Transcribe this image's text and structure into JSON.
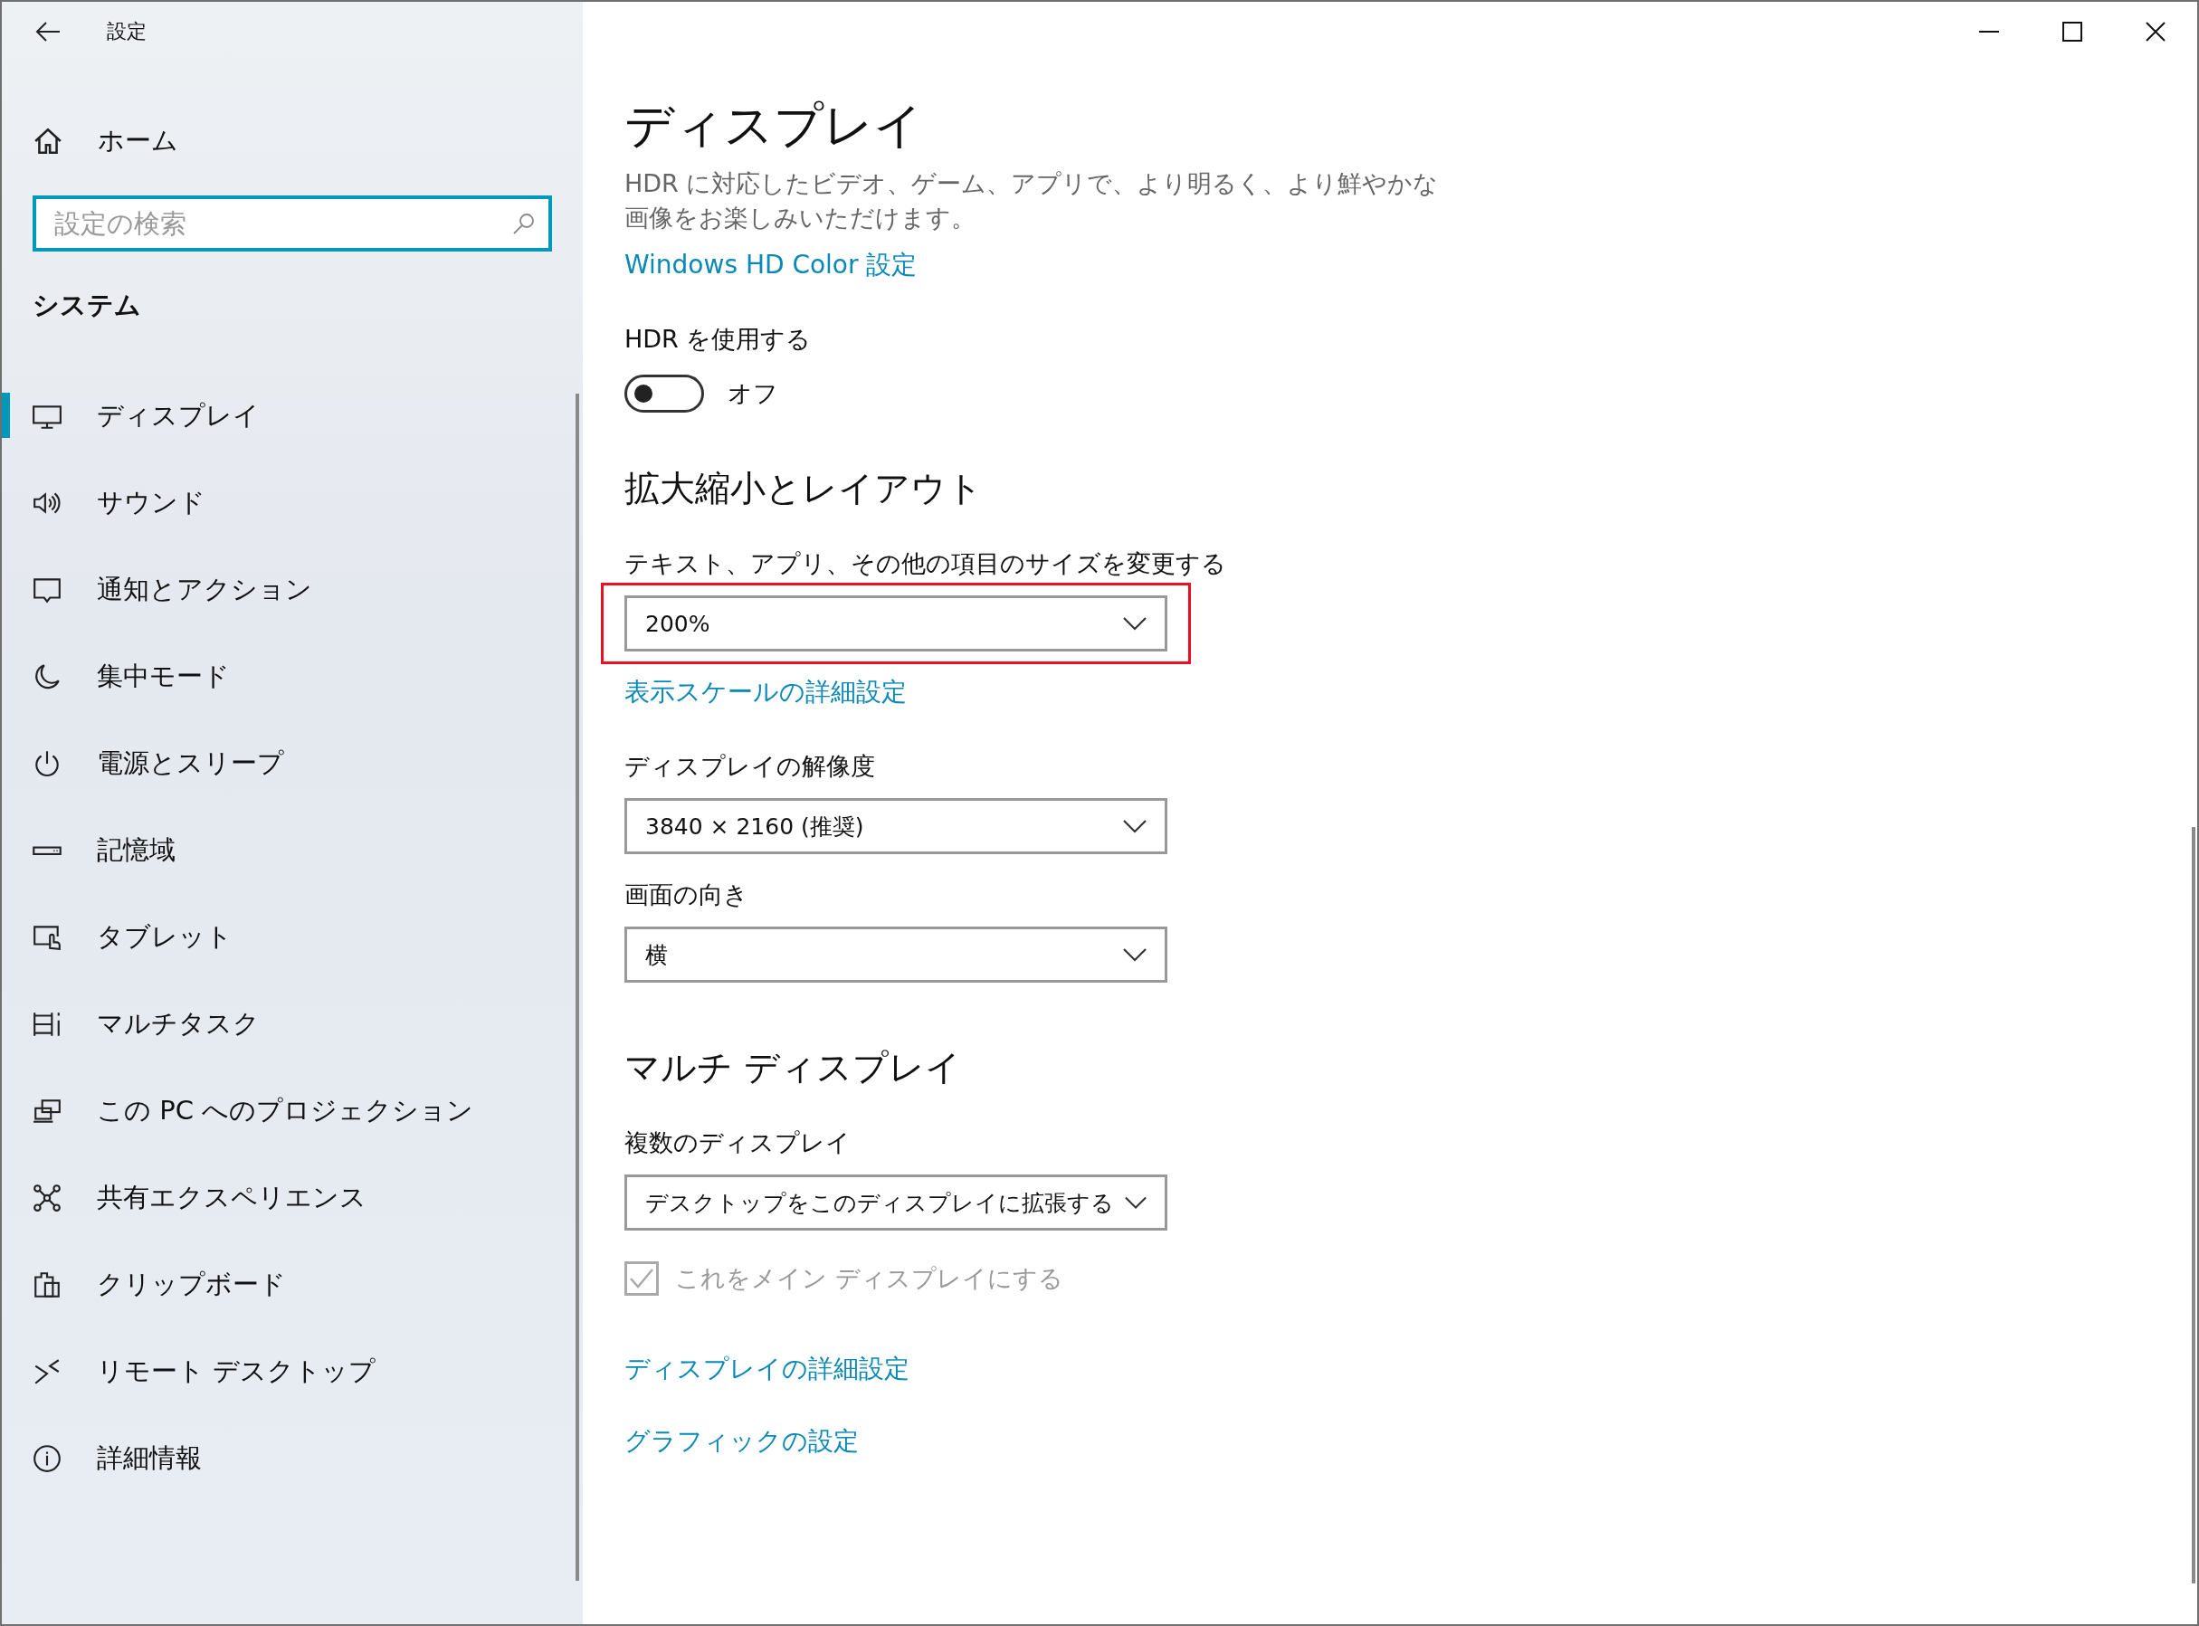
{
  "window": {
    "title": "設定"
  },
  "sidebar": {
    "home": "ホーム",
    "search": {
      "placeholder": "設定の検索"
    },
    "section": "システム",
    "items": [
      {
        "label": "ディスプレイ",
        "selected": true
      },
      {
        "label": "サウンド",
        "selected": false
      },
      {
        "label": "通知とアクション",
        "selected": false
      },
      {
        "label": "集中モード",
        "selected": false
      },
      {
        "label": "電源とスリープ",
        "selected": false
      },
      {
        "label": "記憶域",
        "selected": false
      },
      {
        "label": "タブレット",
        "selected": false
      },
      {
        "label": "マルチタスク",
        "selected": false
      },
      {
        "label": "この PC へのプロジェクション",
        "selected": false
      },
      {
        "label": "共有エクスペリエンス",
        "selected": false
      },
      {
        "label": "クリップボード",
        "selected": false
      },
      {
        "label": "リモート デスクトップ",
        "selected": false
      },
      {
        "label": "詳細情報",
        "selected": false
      }
    ]
  },
  "main": {
    "title": "ディスプレイ",
    "content": [
      {
        "kind": "description",
        "text": "HDR に対応したビデオ、ゲーム、アプリで、より明るく、より鮮やかな画像をお楽しみいただけます。"
      },
      {
        "kind": "link",
        "text": "Windows HD Color 設定"
      },
      {
        "kind": "label",
        "text": "HDR を使用する"
      },
      {
        "kind": "toggle",
        "on": false,
        "state_text": "オフ"
      },
      {
        "kind": "heading",
        "text": "拡大縮小とレイアウト"
      },
      {
        "kind": "label",
        "text": "テキスト、アプリ、その他の項目のサイズを変更する"
      },
      {
        "kind": "dropdown",
        "value": "200%",
        "highlighted": true
      },
      {
        "kind": "link",
        "text": "表示スケールの詳細設定"
      },
      {
        "kind": "label",
        "text": "ディスプレイの解像度"
      },
      {
        "kind": "dropdown",
        "value": "3840 × 2160 (推奨)",
        "highlighted": false
      },
      {
        "kind": "label",
        "text": "画面の向き"
      },
      {
        "kind": "dropdown",
        "value": "横",
        "highlighted": false
      },
      {
        "kind": "heading",
        "text": "マルチ ディスプレイ"
      },
      {
        "kind": "label",
        "text": "複数のディスプレイ"
      },
      {
        "kind": "dropdown",
        "value": "デスクトップをこのディスプレイに拡張する",
        "highlighted": false
      },
      {
        "kind": "checkbox",
        "text": "これをメイン ディスプレイにする",
        "checked": true,
        "disabled": true
      },
      {
        "kind": "link",
        "text": "ディスプレイの詳細設定"
      },
      {
        "kind": "link",
        "text": "グラフィックの設定"
      }
    ]
  }
}
